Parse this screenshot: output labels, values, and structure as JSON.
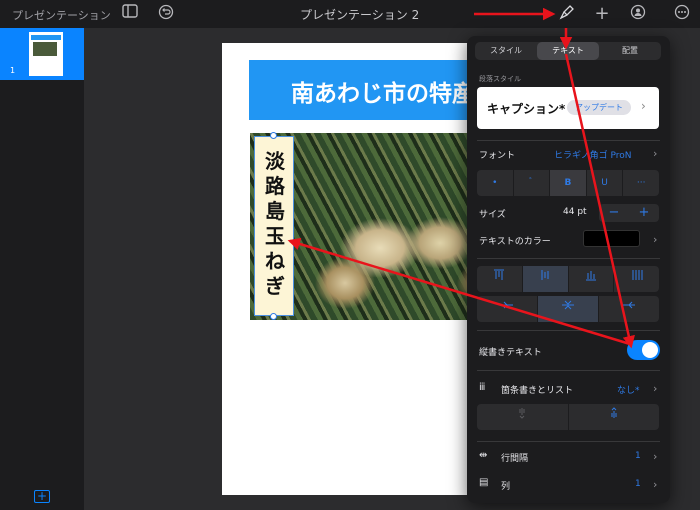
{
  "app": {
    "window_label": "プレゼンテーション",
    "doc_title": "プレゼンテーション 2"
  },
  "toolbar": {
    "sidebar_icon": "sidebar-icon",
    "undo_icon": "undo-icon",
    "format_icon": "paintbrush-icon",
    "add_icon": "plus-icon",
    "collab_icon": "collaborate-icon",
    "more_icon": "more-icon"
  },
  "sidebar": {
    "slides": [
      {
        "number": "1"
      }
    ],
    "add_slide_icon": "add-slide-icon"
  },
  "slide": {
    "title": "南あわじ市の特産",
    "caption_chars": [
      "淡",
      "路",
      "島",
      "玉",
      "ね",
      "ぎ"
    ]
  },
  "inspector": {
    "tabs": [
      "スタイル",
      "テキスト",
      "配置"
    ],
    "active_tab": "テキスト",
    "paragraph_style_label": "段落スタイル",
    "paragraph_style": "キャプション*",
    "update_label": "アップデート",
    "font_label": "フォント",
    "font_value": "ヒラギノ角ゴ ProN",
    "format_buttons": [
      "•",
      "ﾞ",
      "B",
      "U",
      "···"
    ],
    "size_label": "サイズ",
    "size_value": "44 pt",
    "stepper_minus": "−",
    "stepper_plus": "+",
    "text_color_label": "テキストのカラー",
    "text_color_value": "#000000",
    "vertical_text_label": "縦書きテキスト",
    "vertical_text_on": true,
    "bullets_label": "箇条書きとリスト",
    "bullets_value": "なし*",
    "line_spacing_label": "行間隔",
    "line_spacing_value": "1",
    "columns_label": "列",
    "columns_value": "1"
  },
  "colors": {
    "accent": "#0a84ff",
    "title_band": "#2196f3",
    "annotation": "#e8141c"
  }
}
